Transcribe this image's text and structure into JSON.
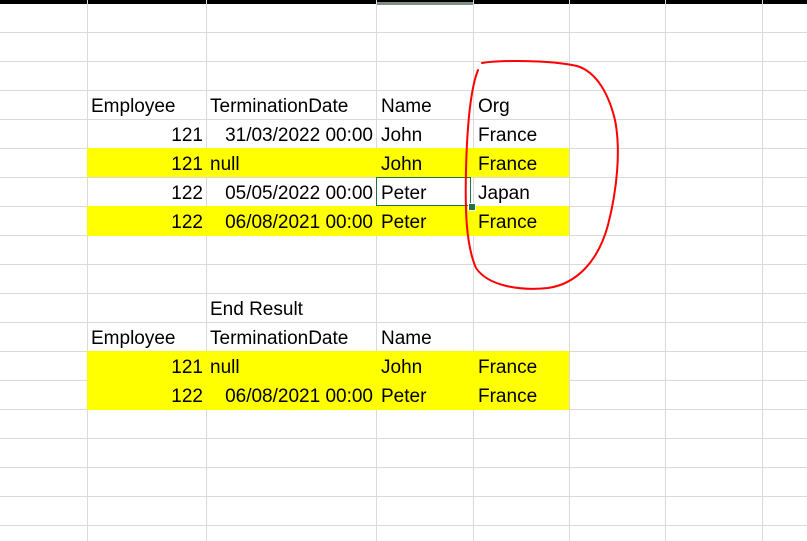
{
  "table1": {
    "headers": [
      "Employee",
      "TerminationDate",
      "Name",
      "Org"
    ],
    "rows": [
      {
        "employee": "121",
        "date": "31/03/2022 00:00",
        "name": "John",
        "org": "France",
        "highlight": false
      },
      {
        "employee": "121",
        "date": "null",
        "name": "John",
        "org": "France",
        "highlight": true
      },
      {
        "employee": "122",
        "date": "05/05/2022 00:00",
        "name": "Peter",
        "org": "Japan",
        "highlight": false
      },
      {
        "employee": "122",
        "date": "06/08/2021 00:00",
        "name": "Peter",
        "org": "France",
        "highlight": true
      }
    ]
  },
  "result": {
    "label": "End Result",
    "headers": [
      "Employee",
      "TerminationDate",
      "Name"
    ],
    "rows": [
      {
        "employee": "121",
        "date": "null",
        "name": "John",
        "org": "France"
      },
      {
        "employee": "122",
        "date": "06/08/2021 00:00",
        "name": "Peter",
        "org": "France"
      }
    ]
  },
  "colors": {
    "highlight": "#ffff00",
    "gridline": "#dadada",
    "selection": "#217346",
    "annotation": "#ff0000"
  }
}
